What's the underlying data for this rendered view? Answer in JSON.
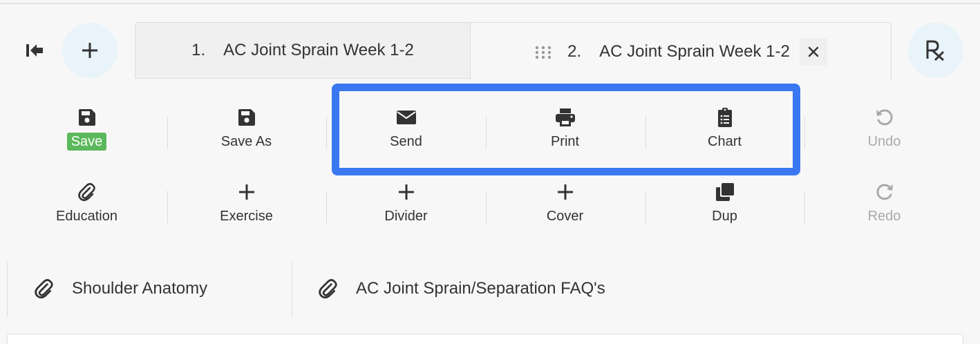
{
  "header": {
    "collapse_icon": "collapse-left-icon",
    "add_icon": "plus-icon",
    "rx_label": "Rx"
  },
  "tabs": [
    {
      "number": "1.",
      "title": "AC Joint Sprain Week 1-2",
      "active": false
    },
    {
      "number": "2.",
      "title": "AC Joint Sprain Week 1-2",
      "active": true
    }
  ],
  "toolbar": {
    "row1": [
      {
        "label": "Save",
        "icon": "save-icon",
        "enabled": true
      },
      {
        "label": "Save As",
        "icon": "save-icon",
        "enabled": true
      },
      {
        "label": "Send",
        "icon": "envelope-icon",
        "enabled": true
      },
      {
        "label": "Print",
        "icon": "printer-icon",
        "enabled": true
      },
      {
        "label": "Chart",
        "icon": "clipboard-list-icon",
        "enabled": true
      },
      {
        "label": "Undo",
        "icon": "undo-icon",
        "enabled": false
      }
    ],
    "row2": [
      {
        "label": "Education",
        "icon": "paperclip-icon",
        "enabled": true
      },
      {
        "label": "Exercise",
        "icon": "plus-icon",
        "enabled": true
      },
      {
        "label": "Divider",
        "icon": "plus-icon",
        "enabled": true
      },
      {
        "label": "Cover",
        "icon": "plus-icon",
        "enabled": true
      },
      {
        "label": "Dup",
        "icon": "duplicate-icon",
        "enabled": true
      },
      {
        "label": "Redo",
        "icon": "redo-icon",
        "enabled": false
      }
    ]
  },
  "colors": {
    "save_badge": "#5cb85c",
    "highlight": "#3a78f2",
    "round_button_bg": "#e8f3fa",
    "disabled_text": "#a9a9a9"
  },
  "attachments": [
    {
      "title": "Shoulder Anatomy",
      "icon": "paperclip-icon"
    },
    {
      "title": "AC Joint Sprain/Separation FAQ's",
      "icon": "paperclip-icon"
    }
  ]
}
